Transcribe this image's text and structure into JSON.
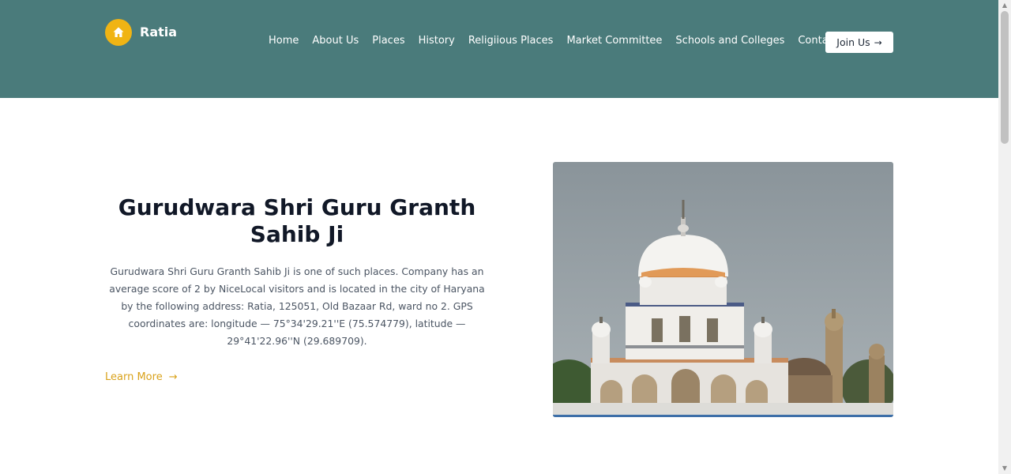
{
  "brand": {
    "name": "Ratia",
    "icon": "home-icon",
    "accent": "#f0b414"
  },
  "header": {
    "background": "#4a7b7b"
  },
  "nav": {
    "items": [
      {
        "label": "Home"
      },
      {
        "label": "About Us"
      },
      {
        "label": "Places"
      },
      {
        "label": "History"
      },
      {
        "label": "Religiious Places"
      },
      {
        "label": "Market Committee"
      },
      {
        "label": "Schools and Colleges"
      },
      {
        "label": "Contact Us"
      }
    ],
    "join_label": "Join Us",
    "join_icon": "arrow-right-icon"
  },
  "hero": {
    "title": "Gurudwara Shri Guru Granth Sahib Ji",
    "description": "Gurudwara Shri Guru Granth Sahib Ji is one of such places. Company has an average score of 2 by NiceLocal visitors and is located in the city of Haryana by the following address: Ratia, 125051, Old Bazaar Rd, ward no 2. GPS coordinates are: longitude — 75°34'29.21''E (75.574779), latitude — 29°41'22.96''N (29.689709).",
    "learn_more_label": "Learn More",
    "learn_more_icon": "arrow-right-icon",
    "link_color": "#d9a21a",
    "image": "gurudwara-photo"
  }
}
